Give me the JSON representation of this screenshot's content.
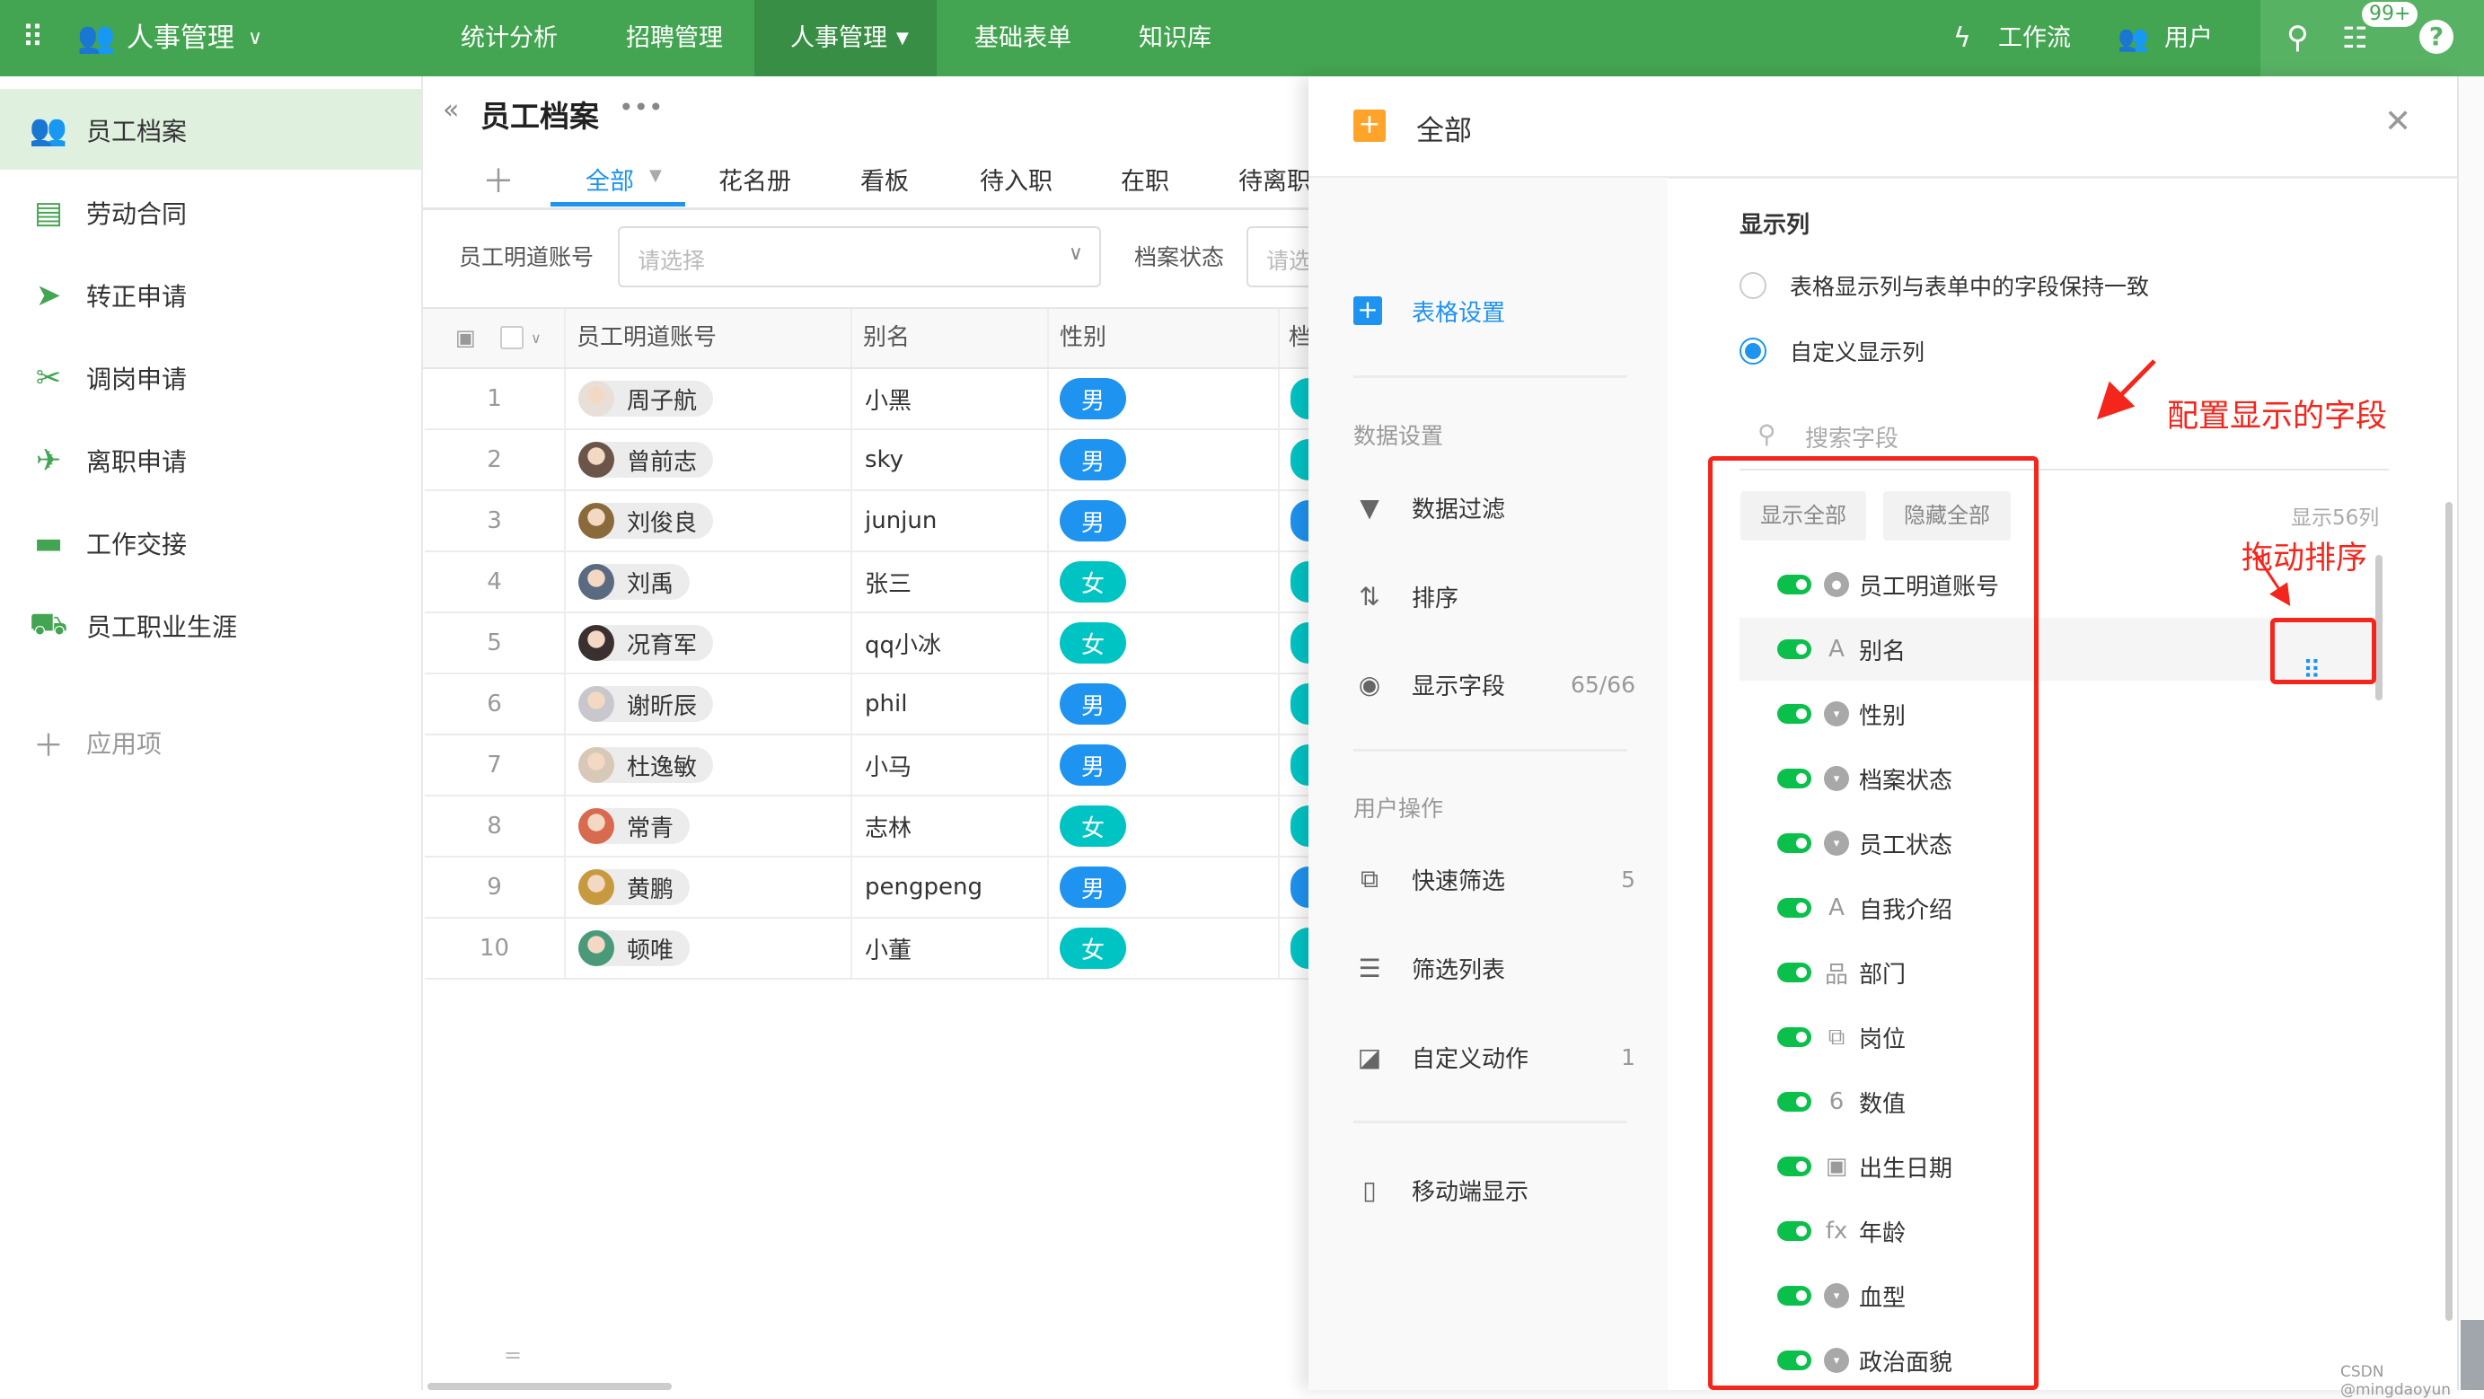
{
  "topbar": {
    "app_name": "人事管理",
    "menu": [
      "统计分析",
      "招聘管理",
      "人事管理",
      "基础表单",
      "知识库"
    ],
    "active_menu_index": 2,
    "workflow": "工作流",
    "users": "用户",
    "badge": "99+"
  },
  "sidebar": {
    "items": [
      {
        "label": "员工档案",
        "icon": "people-icon"
      },
      {
        "label": "劳动合同",
        "icon": "printer-icon"
      },
      {
        "label": "转正申请",
        "icon": "send-icon"
      },
      {
        "label": "调岗申请",
        "icon": "tools-icon"
      },
      {
        "label": "离职申请",
        "icon": "plane-icon"
      },
      {
        "label": "工作交接",
        "icon": "briefcase-icon"
      },
      {
        "label": "员工职业生涯",
        "icon": "truck-icon"
      }
    ],
    "add_label": "应用项"
  },
  "main": {
    "title": "员工档案",
    "tabs": [
      "全部",
      "花名册",
      "看板",
      "待入职",
      "在职",
      "待离职"
    ],
    "filters": [
      {
        "label": "员工明道账号",
        "placeholder": "请选择"
      },
      {
        "label": "档案状态",
        "placeholder": "请选择"
      }
    ],
    "columns": [
      "员工明道账号",
      "别名",
      "性别",
      "档"
    ],
    "rows": [
      {
        "num": "1",
        "name": "周子航",
        "alias": "小黑",
        "gender": "男"
      },
      {
        "num": "2",
        "name": "曾前志",
        "alias": "sky",
        "gender": "男"
      },
      {
        "num": "3",
        "name": "刘俊良",
        "alias": "junjun",
        "gender": "男"
      },
      {
        "num": "4",
        "name": "刘禹",
        "alias": "张三",
        "gender": "女"
      },
      {
        "num": "5",
        "name": "况育军",
        "alias": "qq小冰",
        "gender": "女"
      },
      {
        "num": "6",
        "name": "谢昕辰",
        "alias": "phil",
        "gender": "男"
      },
      {
        "num": "7",
        "name": "杜逸敏",
        "alias": "小马",
        "gender": "男"
      },
      {
        "num": "8",
        "name": "常青",
        "alias": "志林",
        "gender": "女"
      },
      {
        "num": "9",
        "name": "黄鹏",
        "alias": "pengpeng",
        "gender": "男"
      },
      {
        "num": "10",
        "name": "顿唯",
        "alias": "小董",
        "gender": "女"
      }
    ],
    "footer_mark": "="
  },
  "panel": {
    "title": "全部",
    "nav": {
      "table_settings": "表格设置",
      "data_section": "数据设置",
      "data_filter": "数据过滤",
      "sort": "排序",
      "display_fields": "显示字段",
      "display_fields_count": "65/66",
      "user_section": "用户操作",
      "quick_filter": "快速筛选",
      "quick_filter_count": "5",
      "filter_list": "筛选列表",
      "custom_action": "自定义动作",
      "custom_action_count": "1",
      "mobile": "移动端显示"
    },
    "content": {
      "heading": "显示列",
      "radio_same": "表格显示列与表单中的字段保持一致",
      "radio_custom": "自定义显示列",
      "selected_radio": "custom",
      "search_placeholder": "搜索字段",
      "show_all": "显示全部",
      "hide_all": "隐藏全部",
      "shown_count": "显示56列",
      "fields": [
        {
          "label": "员工明道账号",
          "icon": "user-icon",
          "glyph": "●",
          "on": true
        },
        {
          "label": "别名",
          "icon": "text-icon",
          "glyph": "A",
          "on": true
        },
        {
          "label": "性别",
          "icon": "dropdown-icon",
          "glyph": "▾",
          "on": true
        },
        {
          "label": "档案状态",
          "icon": "dropdown-icon",
          "glyph": "▾",
          "on": true
        },
        {
          "label": "员工状态",
          "icon": "dropdown-icon",
          "glyph": "▾",
          "on": true
        },
        {
          "label": "自我介绍",
          "icon": "text-icon",
          "glyph": "A",
          "on": true
        },
        {
          "label": "部门",
          "icon": "department-icon",
          "glyph": "品",
          "on": true
        },
        {
          "label": "岗位",
          "icon": "position-icon",
          "glyph": "⧉",
          "on": true
        },
        {
          "label": "数值",
          "icon": "number-icon",
          "glyph": "6",
          "on": true
        },
        {
          "label": "出生日期",
          "icon": "calendar-icon",
          "glyph": "▣",
          "on": true
        },
        {
          "label": "年龄",
          "icon": "formula-icon",
          "glyph": "fx",
          "on": true
        },
        {
          "label": "血型",
          "icon": "dropdown-icon",
          "glyph": "▾",
          "on": true
        },
        {
          "label": "政治面貌",
          "icon": "dropdown-icon",
          "glyph": "▾",
          "on": true
        }
      ]
    },
    "annotations": {
      "configure": "配置显示的字段",
      "drag": "拖动排序"
    }
  },
  "watermark": "CSDN @mingdaoyun",
  "colors": {
    "brand": "#43a551",
    "male": "#1e93ef",
    "female": "#00c4c4",
    "toggle": "#0bbf4b",
    "annotation": "#f4251b"
  }
}
